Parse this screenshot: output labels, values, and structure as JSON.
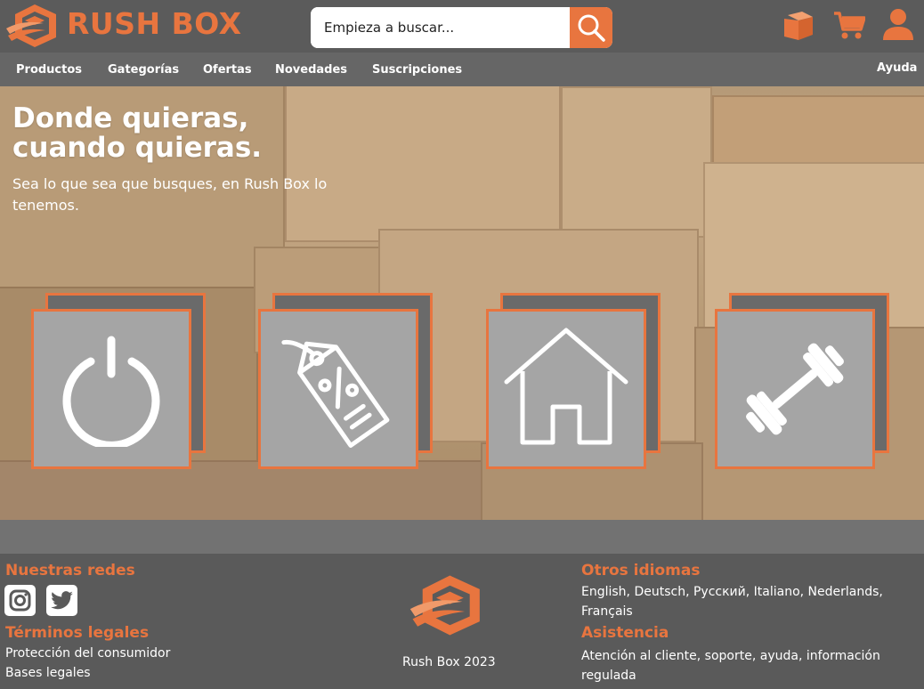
{
  "header": {
    "brand": "RUSH BOX",
    "search_placeholder": "Empieza a buscar...",
    "icons": [
      "package-icon",
      "cart-icon",
      "user-icon"
    ]
  },
  "nav": {
    "items": [
      "Productos",
      "Gategorías",
      "Ofertas",
      "Novedades",
      "Suscripciones"
    ],
    "help": "Ayuda"
  },
  "hero": {
    "title_line1": "Donde quieras,",
    "title_line2": "cuando quieras.",
    "subtitle": "Sea lo que sea que busques, en Rush Box lo tenemos.",
    "tiles": [
      "power-icon",
      "price-tag-icon",
      "home-icon",
      "dumbbell-icon"
    ]
  },
  "footer": {
    "social_heading": "Nuestras redes",
    "social_icons": [
      "instagram-icon",
      "twitter-icon"
    ],
    "legal_heading": "Términos legales",
    "legal_links": [
      "Protección del consumidor",
      "Bases legales"
    ],
    "copyright": "Rush Box 2023",
    "languages_heading": "Otros idiomas",
    "languages": "English, Deutsch, Русский, Italiano, Nederlands, Français",
    "support_heading": "Asistencia",
    "support_text": "Atención al cliente, soporte,  ayuda, información regulada"
  },
  "colors": {
    "accent": "#e8753f",
    "header_bg": "#5b5b5b",
    "nav_bg": "#666666",
    "footer_bg": "#5a5a5a",
    "tile_bg": "#a5a5a5"
  }
}
